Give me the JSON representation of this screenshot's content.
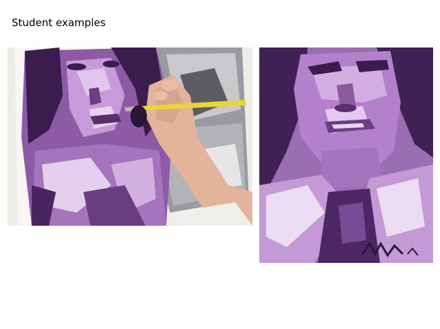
{
  "slide": {
    "title": "Student examples"
  },
  "images": {
    "left": {
      "icon": "painting-in-progress-photo",
      "description_hidden": false
    },
    "right": {
      "icon": "finished-portrait-painting-photo"
    }
  },
  "palette": {
    "deep_purple": "#3a1d4d",
    "mid_purple": "#7a4b95",
    "light_purple": "#b688cc",
    "pale_purple": "#dfc6ea",
    "wall_white": "#f3f1ee",
    "gray_reference": "#8d8d90",
    "brush_yellow": "#e6d63a",
    "skin": "#e9b9a4"
  }
}
